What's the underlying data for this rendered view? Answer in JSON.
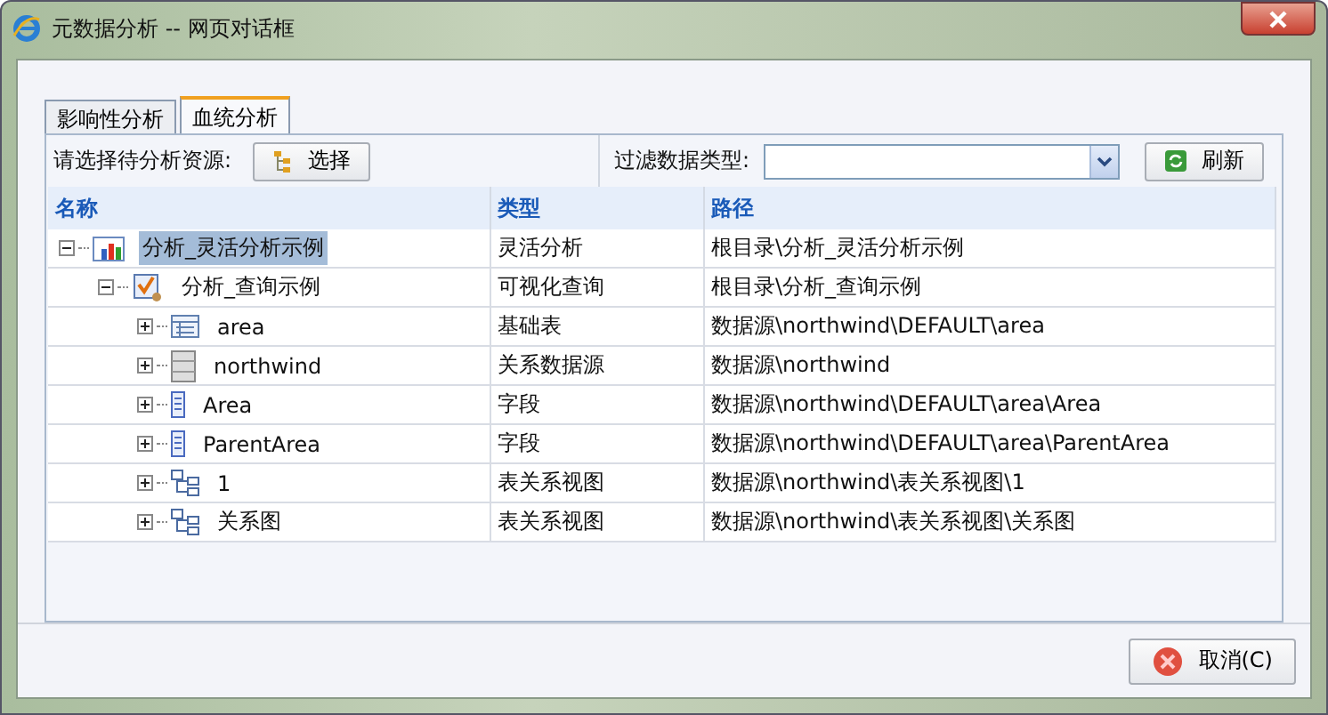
{
  "window": {
    "title": "元数据分析 -- 网页对话框"
  },
  "tabs": [
    {
      "label": "影响性分析",
      "selected": false
    },
    {
      "label": "血统分析",
      "selected": true
    }
  ],
  "toolbar": {
    "source_label": "请选择待分析资源:",
    "select_button": "选择",
    "filter_label": "过滤数据类型:",
    "refresh_button": "刷新"
  },
  "table": {
    "columns": [
      "名称",
      "类型",
      "路径"
    ],
    "rows": [
      {
        "name": "分析_灵活分析示例",
        "kind": "chart",
        "type": "灵活分析",
        "path": "根目录\\分析_灵活分析示例",
        "expanded": true,
        "selected": true,
        "children": [
          {
            "name": "分析_查询示例",
            "kind": "query",
            "type": "可视化查询",
            "path": "根目录\\分析_查询示例",
            "expanded": true,
            "selected": false,
            "children": [
              {
                "name": "area",
                "kind": "table",
                "type": "基础表",
                "path": "数据源\\northwind\\DEFAULT\\area",
                "expanded": false,
                "selected": false
              },
              {
                "name": "northwind",
                "kind": "database",
                "type": "关系数据源",
                "path": "数据源\\northwind",
                "expanded": false,
                "selected": false
              },
              {
                "name": "Area",
                "kind": "field",
                "type": "字段",
                "path": "数据源\\northwind\\DEFAULT\\area\\Area",
                "expanded": false,
                "selected": false
              },
              {
                "name": "ParentArea",
                "kind": "field",
                "type": "字段",
                "path": "数据源\\northwind\\DEFAULT\\area\\ParentArea",
                "expanded": false,
                "selected": false
              },
              {
                "name": "1",
                "kind": "view",
                "type": "表关系视图",
                "path": "数据源\\northwind\\表关系视图\\1",
                "expanded": false,
                "selected": false
              },
              {
                "name": "关系图",
                "kind": "view",
                "type": "表关系视图",
                "path": "数据源\\northwind\\表关系视图\\关系图",
                "expanded": false,
                "selected": false
              }
            ]
          }
        ]
      }
    ]
  },
  "cancel_button": "取消(C)"
}
